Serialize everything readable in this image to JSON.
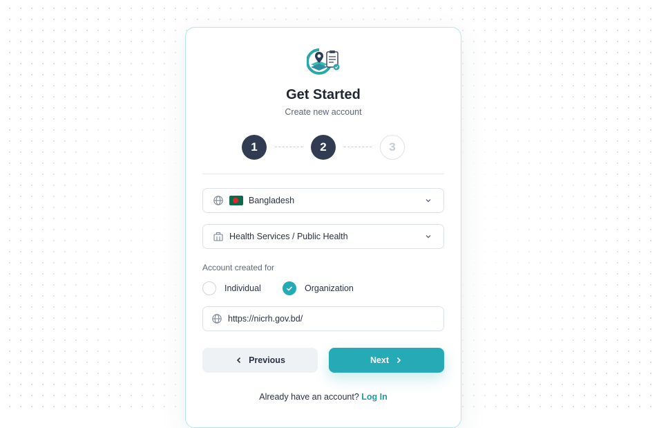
{
  "header": {
    "title": "Get Started",
    "subtitle": "Create new account",
    "logo_icon": "health-map-clipboard-icon"
  },
  "stepper": {
    "steps": [
      {
        "label": "1",
        "state": "complete"
      },
      {
        "label": "2",
        "state": "complete"
      },
      {
        "label": "3",
        "state": "upcoming"
      }
    ]
  },
  "form": {
    "country": {
      "value": "Bangladesh",
      "icon": "globe-icon",
      "flag": "bangladesh-flag"
    },
    "sector": {
      "value": "Health Services / Public Health",
      "icon": "building-icon"
    },
    "account_for": {
      "label": "Account created for",
      "options": [
        {
          "label": "Individual",
          "checked": false
        },
        {
          "label": "Organization",
          "checked": true
        }
      ]
    },
    "website": {
      "value": "https://nicrh.gov.bd/",
      "icon": "globe-icon"
    }
  },
  "actions": {
    "previous_label": "Previous",
    "next_label": "Next"
  },
  "footer": {
    "prompt": "Already have an account?",
    "login_label": "Log In"
  },
  "colors": {
    "accent": "#25aab6",
    "step_done": "#313b52",
    "card_border": "#b6e6ec",
    "flag_green": "#0b6a4a",
    "flag_red": "#e1262d"
  }
}
